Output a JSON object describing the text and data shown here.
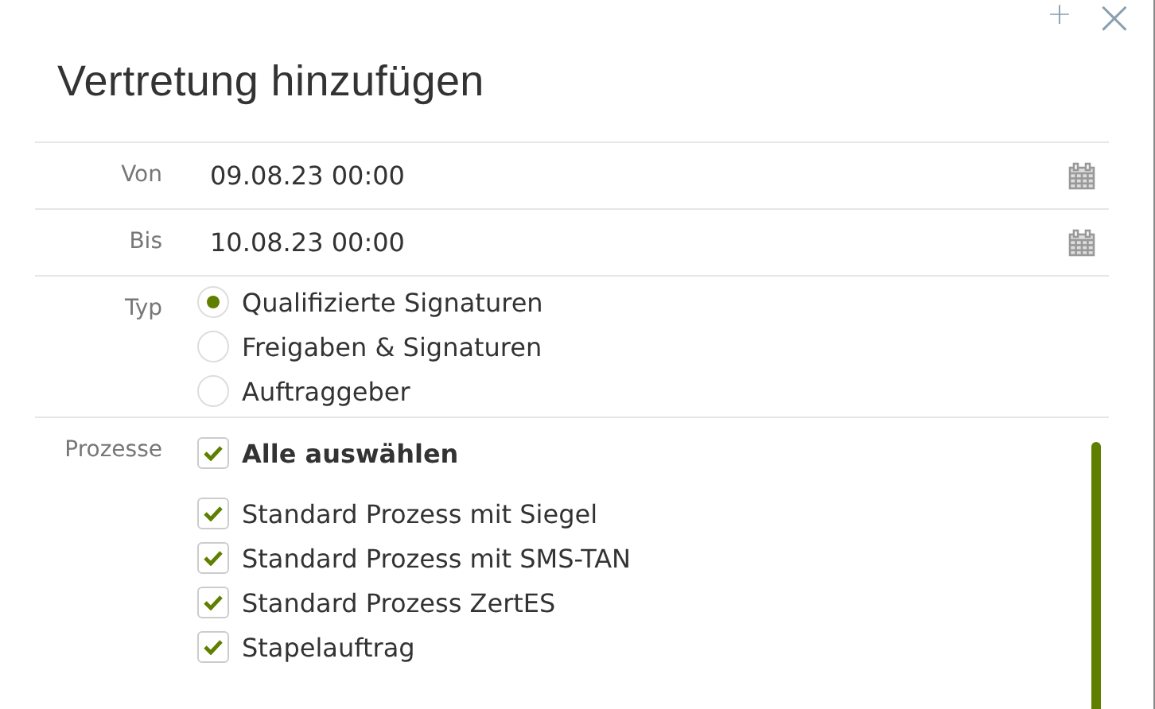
{
  "header": {
    "add": "+",
    "close": "×"
  },
  "title": "Vertretung hinzufügen",
  "dates": [
    {
      "label": "Von",
      "value": "09.08.23 00:00"
    },
    {
      "label": "Bis",
      "value": "10.08.23 00:00"
    }
  ],
  "type": {
    "label": "Typ",
    "options": [
      {
        "label": "Qualifizierte Signaturen",
        "selected": true
      },
      {
        "label": "Freigaben & Signaturen",
        "selected": false
      },
      {
        "label": "Auftraggeber",
        "selected": false
      }
    ]
  },
  "processes": {
    "label": "Prozesse",
    "select_all": {
      "label": "Alle auswählen",
      "checked": true
    },
    "items": [
      {
        "label": "Standard Prozess mit Siegel",
        "checked": true
      },
      {
        "label": "Standard Prozess mit SMS-TAN",
        "checked": true
      },
      {
        "label": "Standard Prozess ZertES",
        "checked": true
      },
      {
        "label": "Stapelauftrag",
        "checked": true
      }
    ]
  }
}
